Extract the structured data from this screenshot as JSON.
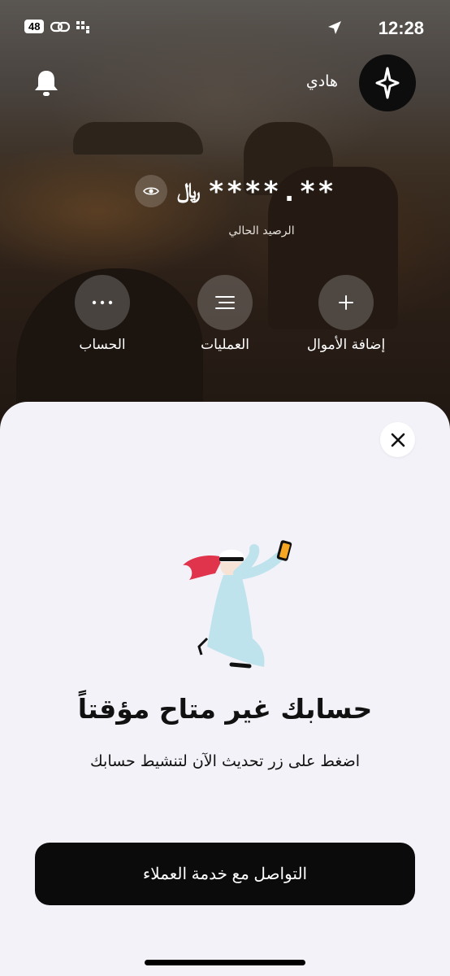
{
  "status_bar": {
    "time": "12:28",
    "network_badge": "48"
  },
  "header": {
    "username": "هادي"
  },
  "balance": {
    "currency_symbol": "﷼",
    "masked_value": "****.**",
    "label": "الرصيد الحالي"
  },
  "actions": [
    {
      "label": "إضافة الأموال",
      "icon": "plus-icon"
    },
    {
      "label": "العمليات",
      "icon": "list-icon"
    },
    {
      "label": "الحساب",
      "icon": "more-icon"
    }
  ],
  "sheet": {
    "title": "حسابك غير متاح مؤقتاً",
    "subtitle": "اضغط على زر تحديث الآن لتنشيط حسابك",
    "cta_label": "التواصل مع خدمة العملاء"
  },
  "colors": {
    "sheet_bg": "#f3f2f8",
    "cta_bg": "#0b0b0b",
    "accent_red": "#e0344c",
    "robe": "#bfe3ec"
  }
}
